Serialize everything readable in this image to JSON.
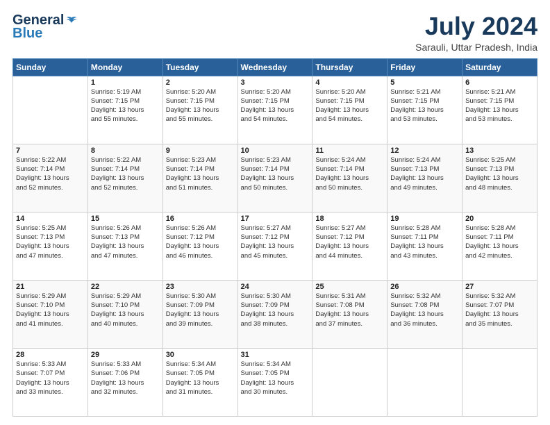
{
  "logo": {
    "general": "General",
    "blue": "Blue"
  },
  "title": {
    "month_year": "July 2024",
    "location": "Sarauli, Uttar Pradesh, India"
  },
  "days_of_week": [
    "Sunday",
    "Monday",
    "Tuesday",
    "Wednesday",
    "Thursday",
    "Friday",
    "Saturday"
  ],
  "weeks": [
    [
      {
        "day": "",
        "info": ""
      },
      {
        "day": "1",
        "info": "Sunrise: 5:19 AM\nSunset: 7:15 PM\nDaylight: 13 hours\nand 55 minutes."
      },
      {
        "day": "2",
        "info": "Sunrise: 5:20 AM\nSunset: 7:15 PM\nDaylight: 13 hours\nand 55 minutes."
      },
      {
        "day": "3",
        "info": "Sunrise: 5:20 AM\nSunset: 7:15 PM\nDaylight: 13 hours\nand 54 minutes."
      },
      {
        "day": "4",
        "info": "Sunrise: 5:20 AM\nSunset: 7:15 PM\nDaylight: 13 hours\nand 54 minutes."
      },
      {
        "day": "5",
        "info": "Sunrise: 5:21 AM\nSunset: 7:15 PM\nDaylight: 13 hours\nand 53 minutes."
      },
      {
        "day": "6",
        "info": "Sunrise: 5:21 AM\nSunset: 7:15 PM\nDaylight: 13 hours\nand 53 minutes."
      }
    ],
    [
      {
        "day": "7",
        "info": "Sunrise: 5:22 AM\nSunset: 7:14 PM\nDaylight: 13 hours\nand 52 minutes."
      },
      {
        "day": "8",
        "info": "Sunrise: 5:22 AM\nSunset: 7:14 PM\nDaylight: 13 hours\nand 52 minutes."
      },
      {
        "day": "9",
        "info": "Sunrise: 5:23 AM\nSunset: 7:14 PM\nDaylight: 13 hours\nand 51 minutes."
      },
      {
        "day": "10",
        "info": "Sunrise: 5:23 AM\nSunset: 7:14 PM\nDaylight: 13 hours\nand 50 minutes."
      },
      {
        "day": "11",
        "info": "Sunrise: 5:24 AM\nSunset: 7:14 PM\nDaylight: 13 hours\nand 50 minutes."
      },
      {
        "day": "12",
        "info": "Sunrise: 5:24 AM\nSunset: 7:13 PM\nDaylight: 13 hours\nand 49 minutes."
      },
      {
        "day": "13",
        "info": "Sunrise: 5:25 AM\nSunset: 7:13 PM\nDaylight: 13 hours\nand 48 minutes."
      }
    ],
    [
      {
        "day": "14",
        "info": "Sunrise: 5:25 AM\nSunset: 7:13 PM\nDaylight: 13 hours\nand 47 minutes."
      },
      {
        "day": "15",
        "info": "Sunrise: 5:26 AM\nSunset: 7:13 PM\nDaylight: 13 hours\nand 47 minutes."
      },
      {
        "day": "16",
        "info": "Sunrise: 5:26 AM\nSunset: 7:12 PM\nDaylight: 13 hours\nand 46 minutes."
      },
      {
        "day": "17",
        "info": "Sunrise: 5:27 AM\nSunset: 7:12 PM\nDaylight: 13 hours\nand 45 minutes."
      },
      {
        "day": "18",
        "info": "Sunrise: 5:27 AM\nSunset: 7:12 PM\nDaylight: 13 hours\nand 44 minutes."
      },
      {
        "day": "19",
        "info": "Sunrise: 5:28 AM\nSunset: 7:11 PM\nDaylight: 13 hours\nand 43 minutes."
      },
      {
        "day": "20",
        "info": "Sunrise: 5:28 AM\nSunset: 7:11 PM\nDaylight: 13 hours\nand 42 minutes."
      }
    ],
    [
      {
        "day": "21",
        "info": "Sunrise: 5:29 AM\nSunset: 7:10 PM\nDaylight: 13 hours\nand 41 minutes."
      },
      {
        "day": "22",
        "info": "Sunrise: 5:29 AM\nSunset: 7:10 PM\nDaylight: 13 hours\nand 40 minutes."
      },
      {
        "day": "23",
        "info": "Sunrise: 5:30 AM\nSunset: 7:09 PM\nDaylight: 13 hours\nand 39 minutes."
      },
      {
        "day": "24",
        "info": "Sunrise: 5:30 AM\nSunset: 7:09 PM\nDaylight: 13 hours\nand 38 minutes."
      },
      {
        "day": "25",
        "info": "Sunrise: 5:31 AM\nSunset: 7:08 PM\nDaylight: 13 hours\nand 37 minutes."
      },
      {
        "day": "26",
        "info": "Sunrise: 5:32 AM\nSunset: 7:08 PM\nDaylight: 13 hours\nand 36 minutes."
      },
      {
        "day": "27",
        "info": "Sunrise: 5:32 AM\nSunset: 7:07 PM\nDaylight: 13 hours\nand 35 minutes."
      }
    ],
    [
      {
        "day": "28",
        "info": "Sunrise: 5:33 AM\nSunset: 7:07 PM\nDaylight: 13 hours\nand 33 minutes."
      },
      {
        "day": "29",
        "info": "Sunrise: 5:33 AM\nSunset: 7:06 PM\nDaylight: 13 hours\nand 32 minutes."
      },
      {
        "day": "30",
        "info": "Sunrise: 5:34 AM\nSunset: 7:05 PM\nDaylight: 13 hours\nand 31 minutes."
      },
      {
        "day": "31",
        "info": "Sunrise: 5:34 AM\nSunset: 7:05 PM\nDaylight: 13 hours\nand 30 minutes."
      },
      {
        "day": "",
        "info": ""
      },
      {
        "day": "",
        "info": ""
      },
      {
        "day": "",
        "info": ""
      }
    ]
  ]
}
